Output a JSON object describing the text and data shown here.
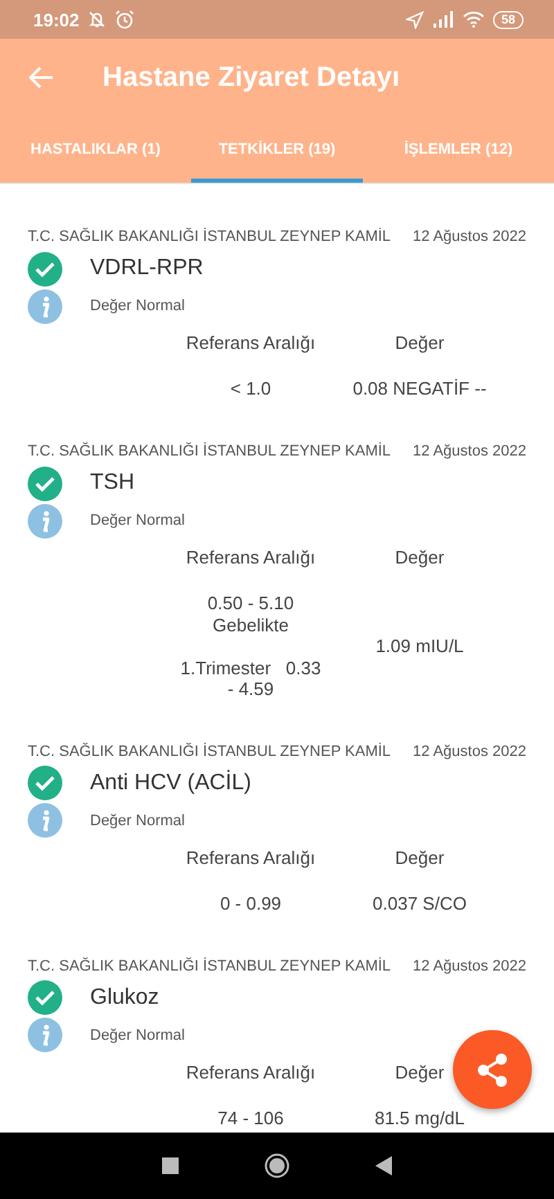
{
  "status_bar": {
    "time": "19:02",
    "battery": "58"
  },
  "app_bar": {
    "title": "Hastane Ziyaret Detayı"
  },
  "tabs": [
    {
      "label": "HASTALIKLAR (1)",
      "selected": false
    },
    {
      "label": "TETKİKLER (19)",
      "selected": true
    },
    {
      "label": "İŞLEMLER (12)",
      "selected": false
    }
  ],
  "records": [
    {
      "hospital": "T.C. SAĞLIK BAKANLIĞI İSTANBUL ZEYNEP KAMİL",
      "date": "12 Ağustos 2022",
      "name": "VDRL-RPR",
      "normal": true,
      "note": "Değer Normal",
      "reference_label": "Referans Aralığı",
      "value_label": "Değer",
      "reference": "< 1.0",
      "value": "0.08 NEGATİF --"
    },
    {
      "hospital": "T.C. SAĞLIK BAKANLIĞI İSTANBUL ZEYNEP KAMİL",
      "date": "12 Ağustos 2022",
      "name": "TSH",
      "normal": true,
      "note": "Değer Normal",
      "reference_label": "Referans Aralığı",
      "value_label": "Değer",
      "reference": "0.50 - 5.10\nGebelikte\n\n1.Trimester   0.33 - 4.59",
      "value": "1.09 mIU/L"
    },
    {
      "hospital": "T.C. SAĞLIK BAKANLIĞI İSTANBUL ZEYNEP KAMİL",
      "date": "12 Ağustos 2022",
      "name": "Anti HCV (ACİL)",
      "normal": true,
      "note": "Değer Normal",
      "reference_label": "Referans Aralığı",
      "value_label": "Değer",
      "reference": "0 - 0.99",
      "value": "0.037 S/CO"
    },
    {
      "hospital": "T.C. SAĞLIK BAKANLIĞI İSTANBUL ZEYNEP KAMİL",
      "date": "12 Ağustos 2022",
      "name": "Glukoz",
      "normal": true,
      "note": "Değer Normal",
      "reference_label": "Referans Aralığı",
      "value_label": "Değer",
      "reference": "74 - 106",
      "value": "81.5 mg/dL"
    }
  ]
}
